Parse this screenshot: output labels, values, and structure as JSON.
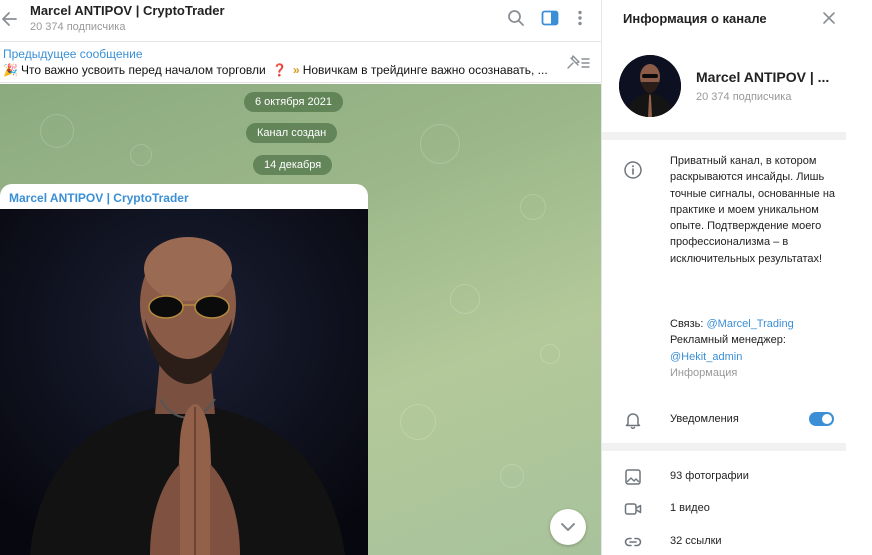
{
  "chat": {
    "title": "Marcel ANTIPOV | CryptoTrader",
    "subscribers": "20 374 подписчика",
    "icons": [
      "back-arrow-icon",
      "search-icon",
      "sidebar-toggle-icon",
      "more-vertical-icon"
    ]
  },
  "pinned": {
    "label": "Предыдущее сообщение",
    "text_part1": "Что важно усвоить перед началом торговли",
    "text_part2": "Новичкам в трейдинге важно осознавать, ...",
    "emoji_1": "🎉",
    "emoji_2": "❓",
    "emoji_3": "»"
  },
  "timeline": {
    "date_1": "6 октября 2021",
    "service": "Канал создан",
    "date_2": "14 декабря"
  },
  "message": {
    "author": "Marcel ANTIPOV | CryptoTrader"
  },
  "info_panel": {
    "title": "Информация о канале",
    "name": "Marcel ANTIPOV | ...",
    "subscribers": "20 374 подписчика",
    "description": "Приватный канал, в котором раскрываются инсайды. Лишь точные сигналы, основанные на практике и моем уникальном опыте. Подтверждение моего профессионализма – в исключительных результатах!",
    "contact_label": "Связь: ",
    "contact_link": "@Marcel_Trading",
    "ad_label": "Рекламный менеджер:",
    "ad_link": "@Hekit_admin",
    "caption": "Информация",
    "notifications_label": "Уведомления",
    "notifications_on": true,
    "media": [
      {
        "label": "93 фотографии",
        "icon": "photo-icon"
      },
      {
        "label": "1 видео",
        "icon": "video-icon"
      },
      {
        "label": "32 ссылки",
        "icon": "link-icon"
      }
    ]
  },
  "colors": {
    "accent": "#3a8fd6",
    "chat_background": "#9cb88a",
    "date_pill": "#52764a"
  }
}
